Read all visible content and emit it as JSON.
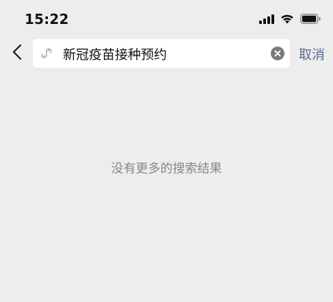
{
  "status_bar": {
    "time": "15:22",
    "icons": [
      "cellular-signal-icon",
      "wifi-icon",
      "battery-icon"
    ]
  },
  "search": {
    "query": "新冠疫苗接种预约",
    "icon": "mini-program-icon",
    "clear_icon": "clear-icon",
    "back_icon": "chevron-left-icon",
    "cancel_label": "取消"
  },
  "results": {
    "empty_message": "没有更多的搜索结果"
  },
  "colors": {
    "background": "#ededed",
    "search_box": "#ffffff",
    "link": "#576b95",
    "muted_text": "#888888"
  }
}
